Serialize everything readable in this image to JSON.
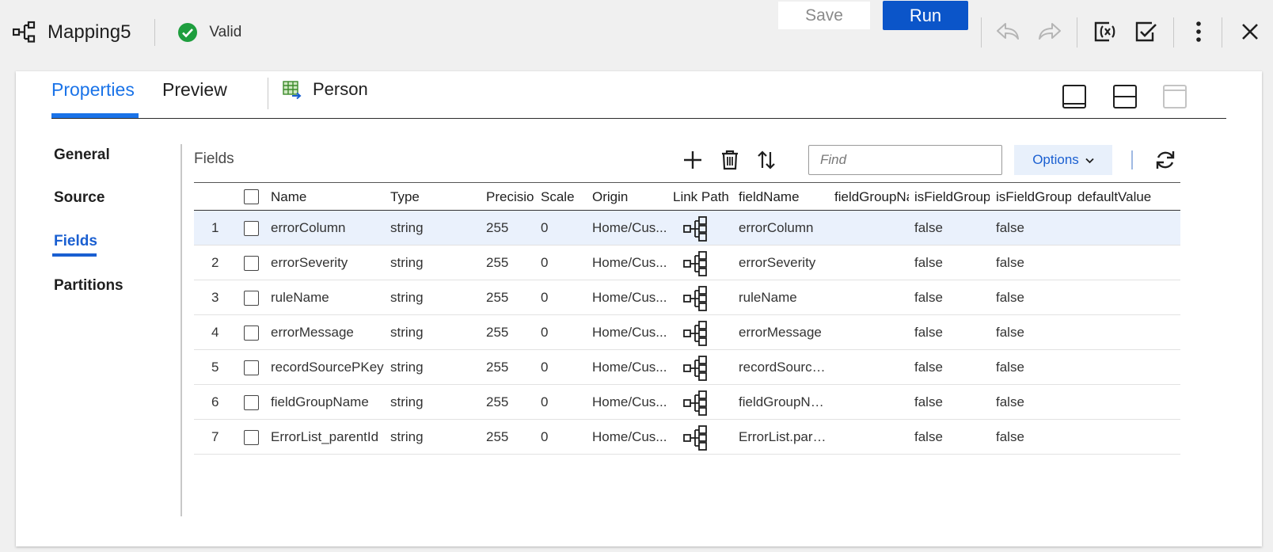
{
  "header": {
    "mapping_name": "Mapping5",
    "status_text": "Valid",
    "save_label": "Save",
    "run_label": "Run",
    "accent_color": "#0b55c9",
    "valid_color": "#1e9e3e"
  },
  "tabs": {
    "properties": "Properties",
    "preview": "Preview",
    "object_name": "Person",
    "active": "Properties"
  },
  "nav": {
    "items": [
      "General",
      "Source",
      "Fields",
      "Partitions"
    ],
    "active": "Fields"
  },
  "fields": {
    "title": "Fields",
    "find_placeholder": "Find",
    "options_label": "Options",
    "columns": [
      "Name",
      "Type",
      "Precisio",
      "Scale",
      "Origin",
      "Link Path",
      "fieldName",
      "fieldGroupNa",
      "isFieldGroup",
      "isFieldGroup",
      "defaultValue"
    ],
    "rows": [
      {
        "num": "1",
        "name": "errorColumn",
        "type": "string",
        "precision": "255",
        "scale": "0",
        "origin": "Home/Cus...",
        "fieldName": "errorColumn",
        "fieldGroupName": "",
        "isFieldGroup1": "false",
        "isFieldGroup2": "false",
        "defaultValue": "",
        "selected": true
      },
      {
        "num": "2",
        "name": "errorSeverity",
        "type": "string",
        "precision": "255",
        "scale": "0",
        "origin": "Home/Cus...",
        "fieldName": "errorSeverity",
        "fieldGroupName": "",
        "isFieldGroup1": "false",
        "isFieldGroup2": "false",
        "defaultValue": ""
      },
      {
        "num": "3",
        "name": "ruleName",
        "type": "string",
        "precision": "255",
        "scale": "0",
        "origin": "Home/Cus...",
        "fieldName": "ruleName",
        "fieldGroupName": "",
        "isFieldGroup1": "false",
        "isFieldGroup2": "false",
        "defaultValue": ""
      },
      {
        "num": "4",
        "name": "errorMessage",
        "type": "string",
        "precision": "255",
        "scale": "0",
        "origin": "Home/Cus...",
        "fieldName": "errorMessage",
        "fieldGroupName": "",
        "isFieldGroup1": "false",
        "isFieldGroup2": "false",
        "defaultValue": ""
      },
      {
        "num": "5",
        "name": "recordSourcePKey",
        "type": "string",
        "precision": "255",
        "scale": "0",
        "origin": "Home/Cus...",
        "fieldName": "recordSource...",
        "fieldGroupName": "",
        "isFieldGroup1": "false",
        "isFieldGroup2": "false",
        "defaultValue": ""
      },
      {
        "num": "6",
        "name": "fieldGroupName",
        "type": "string",
        "precision": "255",
        "scale": "0",
        "origin": "Home/Cus...",
        "fieldName": "fieldGroupNa...",
        "fieldGroupName": "",
        "isFieldGroup1": "false",
        "isFieldGroup2": "false",
        "defaultValue": ""
      },
      {
        "num": "7",
        "name": "ErrorList_parentId",
        "type": "string",
        "precision": "255",
        "scale": "0",
        "origin": "Home/Cus...",
        "fieldName": "ErrorList.pare...",
        "fieldGroupName": "",
        "isFieldGroup1": "false",
        "isFieldGroup2": "false",
        "defaultValue": ""
      }
    ]
  },
  "icons": {
    "mapping": "mapping-icon",
    "valid": "check-circle-icon",
    "undo": "undo-icon",
    "redo": "redo-icon",
    "clear_validate": "clear-validation-icon",
    "validate": "validate-icon",
    "more": "more-vertical-icon",
    "close": "close-icon",
    "person_object": "table-object-icon",
    "layout_bottom": "layout-bottom-panel-icon",
    "layout_split": "layout-split-icon",
    "layout_top": "layout-top-panel-icon",
    "add": "plus-icon",
    "delete": "trash-icon",
    "sort": "sort-icon",
    "options_caret": "chevron-down-icon",
    "refresh": "refresh-icon",
    "link_path": "link-path-icon"
  }
}
